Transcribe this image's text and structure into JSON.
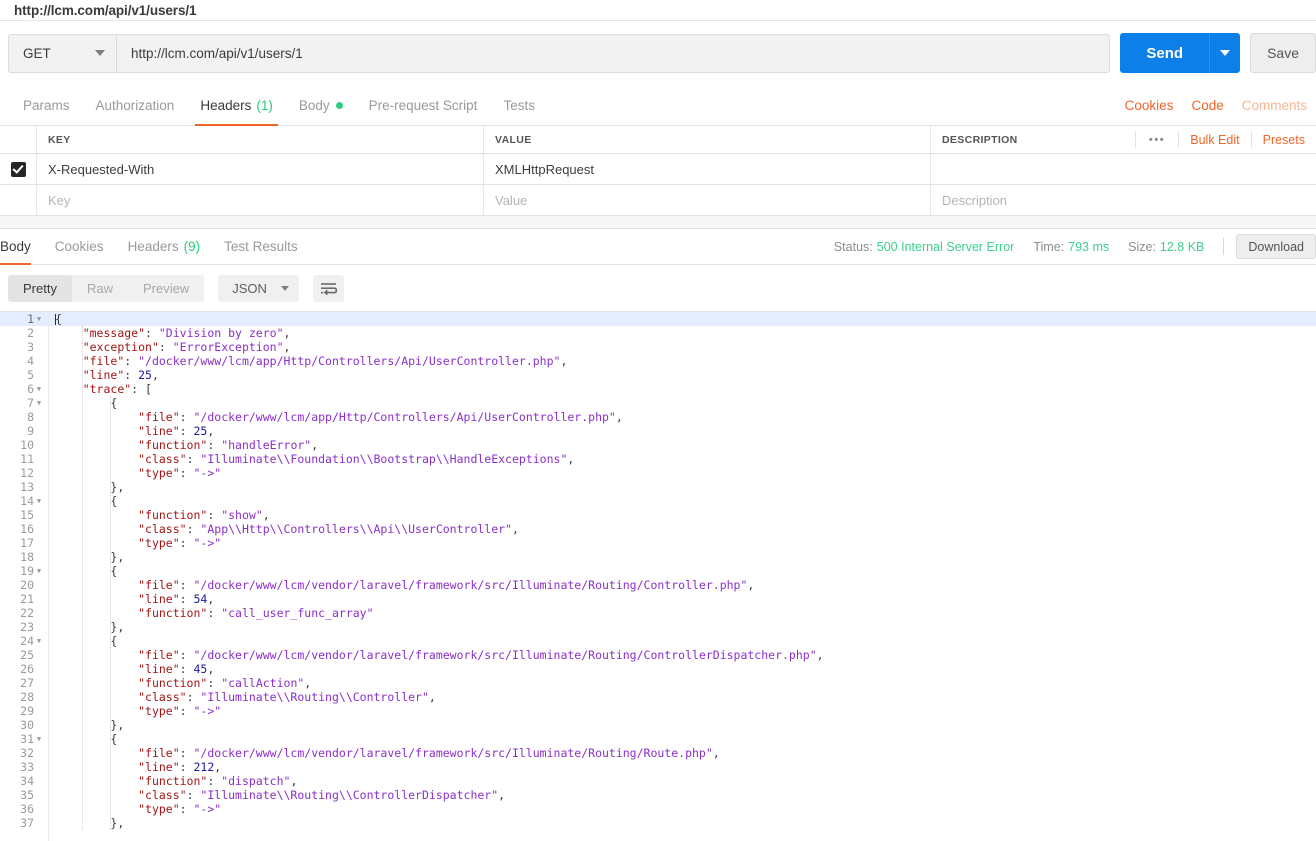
{
  "titlebar": {
    "request_title": "http://lcm.com/api/v1/users/1"
  },
  "request": {
    "method": "GET",
    "url": "http://lcm.com/api/v1/users/1",
    "send_label": "Send",
    "save_label": "Save",
    "tabs": [
      {
        "label": "Params",
        "active": false
      },
      {
        "label": "Authorization",
        "active": false
      },
      {
        "label": "Headers",
        "count": "(1)",
        "active": true
      },
      {
        "label": "Body",
        "dot": true,
        "active": false
      },
      {
        "label": "Pre-request Script",
        "active": false
      },
      {
        "label": "Tests",
        "active": false
      }
    ],
    "right_links": [
      {
        "label": "Cookies",
        "muted": false
      },
      {
        "label": "Code",
        "muted": false
      },
      {
        "label": "Comments",
        "muted": true
      }
    ]
  },
  "headers_table": {
    "columns": [
      "KEY",
      "VALUE",
      "DESCRIPTION"
    ],
    "more_dots": "•••",
    "bulk_edit_label": "Bulk Edit",
    "presets_label": "Presets",
    "rows": [
      {
        "checked": true,
        "key": "X-Requested-With",
        "value": "XMLHttpRequest",
        "description": ""
      }
    ],
    "placeholder_row": {
      "key": "Key",
      "value": "Value",
      "description": "Description"
    }
  },
  "response": {
    "tabs": [
      {
        "label": "Body",
        "active": true
      },
      {
        "label": "Cookies",
        "active": false
      },
      {
        "label": "Headers",
        "count": "(9)",
        "active": false
      },
      {
        "label": "Test Results",
        "active": false
      }
    ],
    "status_label": "Status:",
    "status_value": "500 Internal Server Error",
    "time_label": "Time:",
    "time_value": "793 ms",
    "size_label": "Size:",
    "size_value": "12.8 KB",
    "download_label": "Download",
    "view_modes": [
      {
        "label": "Pretty",
        "active": true
      },
      {
        "label": "Raw",
        "active": false
      },
      {
        "label": "Preview",
        "active": false
      }
    ],
    "format": "JSON",
    "wrap_icon": "word-wrap-icon"
  },
  "colors": {
    "accent_orange": "#f06529",
    "send_blue": "#0d7fe9",
    "status_green": "#3ccf8e",
    "active_line": "#e3edfd"
  },
  "code": {
    "active_line": 1,
    "fold_lines": [
      1,
      6,
      7,
      14,
      19,
      24,
      31
    ],
    "lines": [
      {
        "n": 1,
        "indent": 0,
        "tokens": [
          {
            "t": "punc",
            "v": "{"
          }
        ]
      },
      {
        "n": 2,
        "indent": 1,
        "tokens": [
          {
            "t": "key",
            "v": "\"message\""
          },
          {
            "t": "punc",
            "v": ": "
          },
          {
            "t": "str",
            "v": "\"Division by zero\""
          },
          {
            "t": "punc",
            "v": ","
          }
        ]
      },
      {
        "n": 3,
        "indent": 1,
        "tokens": [
          {
            "t": "key",
            "v": "\"exception\""
          },
          {
            "t": "punc",
            "v": ": "
          },
          {
            "t": "str",
            "v": "\"ErrorException\""
          },
          {
            "t": "punc",
            "v": ","
          }
        ]
      },
      {
        "n": 4,
        "indent": 1,
        "tokens": [
          {
            "t": "key",
            "v": "\"file\""
          },
          {
            "t": "punc",
            "v": ": "
          },
          {
            "t": "str",
            "v": "\"/docker/www/lcm/app/Http/Controllers/Api/UserController.php\""
          },
          {
            "t": "punc",
            "v": ","
          }
        ]
      },
      {
        "n": 5,
        "indent": 1,
        "tokens": [
          {
            "t": "key",
            "v": "\"line\""
          },
          {
            "t": "punc",
            "v": ": "
          },
          {
            "t": "num",
            "v": "25"
          },
          {
            "t": "punc",
            "v": ","
          }
        ]
      },
      {
        "n": 6,
        "indent": 1,
        "tokens": [
          {
            "t": "key",
            "v": "\"trace\""
          },
          {
            "t": "punc",
            "v": ": ["
          }
        ]
      },
      {
        "n": 7,
        "indent": 2,
        "tokens": [
          {
            "t": "punc",
            "v": "{"
          }
        ]
      },
      {
        "n": 8,
        "indent": 3,
        "tokens": [
          {
            "t": "key",
            "v": "\"file\""
          },
          {
            "t": "punc",
            "v": ": "
          },
          {
            "t": "str",
            "v": "\"/docker/www/lcm/app/Http/Controllers/Api/UserController.php\""
          },
          {
            "t": "punc",
            "v": ","
          }
        ]
      },
      {
        "n": 9,
        "indent": 3,
        "tokens": [
          {
            "t": "key",
            "v": "\"line\""
          },
          {
            "t": "punc",
            "v": ": "
          },
          {
            "t": "num",
            "v": "25"
          },
          {
            "t": "punc",
            "v": ","
          }
        ]
      },
      {
        "n": 10,
        "indent": 3,
        "tokens": [
          {
            "t": "key",
            "v": "\"function\""
          },
          {
            "t": "punc",
            "v": ": "
          },
          {
            "t": "str",
            "v": "\"handleError\""
          },
          {
            "t": "punc",
            "v": ","
          }
        ]
      },
      {
        "n": 11,
        "indent": 3,
        "tokens": [
          {
            "t": "key",
            "v": "\"class\""
          },
          {
            "t": "punc",
            "v": ": "
          },
          {
            "t": "str",
            "v": "\"Illuminate\\\\Foundation\\\\Bootstrap\\\\HandleExceptions\""
          },
          {
            "t": "punc",
            "v": ","
          }
        ]
      },
      {
        "n": 12,
        "indent": 3,
        "tokens": [
          {
            "t": "key",
            "v": "\"type\""
          },
          {
            "t": "punc",
            "v": ": "
          },
          {
            "t": "str",
            "v": "\"->\""
          }
        ]
      },
      {
        "n": 13,
        "indent": 2,
        "tokens": [
          {
            "t": "punc",
            "v": "},"
          }
        ]
      },
      {
        "n": 14,
        "indent": 2,
        "tokens": [
          {
            "t": "punc",
            "v": "{"
          }
        ]
      },
      {
        "n": 15,
        "indent": 3,
        "tokens": [
          {
            "t": "key",
            "v": "\"function\""
          },
          {
            "t": "punc",
            "v": ": "
          },
          {
            "t": "str",
            "v": "\"show\""
          },
          {
            "t": "punc",
            "v": ","
          }
        ]
      },
      {
        "n": 16,
        "indent": 3,
        "tokens": [
          {
            "t": "key",
            "v": "\"class\""
          },
          {
            "t": "punc",
            "v": ": "
          },
          {
            "t": "str",
            "v": "\"App\\\\Http\\\\Controllers\\\\Api\\\\UserController\""
          },
          {
            "t": "punc",
            "v": ","
          }
        ]
      },
      {
        "n": 17,
        "indent": 3,
        "tokens": [
          {
            "t": "key",
            "v": "\"type\""
          },
          {
            "t": "punc",
            "v": ": "
          },
          {
            "t": "str",
            "v": "\"->\""
          }
        ]
      },
      {
        "n": 18,
        "indent": 2,
        "tokens": [
          {
            "t": "punc",
            "v": "},"
          }
        ]
      },
      {
        "n": 19,
        "indent": 2,
        "tokens": [
          {
            "t": "punc",
            "v": "{"
          }
        ]
      },
      {
        "n": 20,
        "indent": 3,
        "tokens": [
          {
            "t": "key",
            "v": "\"file\""
          },
          {
            "t": "punc",
            "v": ": "
          },
          {
            "t": "str",
            "v": "\"/docker/www/lcm/vendor/laravel/framework/src/Illuminate/Routing/Controller.php\""
          },
          {
            "t": "punc",
            "v": ","
          }
        ]
      },
      {
        "n": 21,
        "indent": 3,
        "tokens": [
          {
            "t": "key",
            "v": "\"line\""
          },
          {
            "t": "punc",
            "v": ": "
          },
          {
            "t": "num",
            "v": "54"
          },
          {
            "t": "punc",
            "v": ","
          }
        ]
      },
      {
        "n": 22,
        "indent": 3,
        "tokens": [
          {
            "t": "key",
            "v": "\"function\""
          },
          {
            "t": "punc",
            "v": ": "
          },
          {
            "t": "str",
            "v": "\"call_user_func_array\""
          }
        ]
      },
      {
        "n": 23,
        "indent": 2,
        "tokens": [
          {
            "t": "punc",
            "v": "},"
          }
        ]
      },
      {
        "n": 24,
        "indent": 2,
        "tokens": [
          {
            "t": "punc",
            "v": "{"
          }
        ]
      },
      {
        "n": 25,
        "indent": 3,
        "tokens": [
          {
            "t": "key",
            "v": "\"file\""
          },
          {
            "t": "punc",
            "v": ": "
          },
          {
            "t": "str",
            "v": "\"/docker/www/lcm/vendor/laravel/framework/src/Illuminate/Routing/ControllerDispatcher.php\""
          },
          {
            "t": "punc",
            "v": ","
          }
        ]
      },
      {
        "n": 26,
        "indent": 3,
        "tokens": [
          {
            "t": "key",
            "v": "\"line\""
          },
          {
            "t": "punc",
            "v": ": "
          },
          {
            "t": "num",
            "v": "45"
          },
          {
            "t": "punc",
            "v": ","
          }
        ]
      },
      {
        "n": 27,
        "indent": 3,
        "tokens": [
          {
            "t": "key",
            "v": "\"function\""
          },
          {
            "t": "punc",
            "v": ": "
          },
          {
            "t": "str",
            "v": "\"callAction\""
          },
          {
            "t": "punc",
            "v": ","
          }
        ]
      },
      {
        "n": 28,
        "indent": 3,
        "tokens": [
          {
            "t": "key",
            "v": "\"class\""
          },
          {
            "t": "punc",
            "v": ": "
          },
          {
            "t": "str",
            "v": "\"Illuminate\\\\Routing\\\\Controller\""
          },
          {
            "t": "punc",
            "v": ","
          }
        ]
      },
      {
        "n": 29,
        "indent": 3,
        "tokens": [
          {
            "t": "key",
            "v": "\"type\""
          },
          {
            "t": "punc",
            "v": ": "
          },
          {
            "t": "str",
            "v": "\"->\""
          }
        ]
      },
      {
        "n": 30,
        "indent": 2,
        "tokens": [
          {
            "t": "punc",
            "v": "},"
          }
        ]
      },
      {
        "n": 31,
        "indent": 2,
        "tokens": [
          {
            "t": "punc",
            "v": "{"
          }
        ]
      },
      {
        "n": 32,
        "indent": 3,
        "tokens": [
          {
            "t": "key",
            "v": "\"file\""
          },
          {
            "t": "punc",
            "v": ": "
          },
          {
            "t": "str",
            "v": "\"/docker/www/lcm/vendor/laravel/framework/src/Illuminate/Routing/Route.php\""
          },
          {
            "t": "punc",
            "v": ","
          }
        ]
      },
      {
        "n": 33,
        "indent": 3,
        "tokens": [
          {
            "t": "key",
            "v": "\"line\""
          },
          {
            "t": "punc",
            "v": ": "
          },
          {
            "t": "num",
            "v": "212"
          },
          {
            "t": "punc",
            "v": ","
          }
        ]
      },
      {
        "n": 34,
        "indent": 3,
        "tokens": [
          {
            "t": "key",
            "v": "\"function\""
          },
          {
            "t": "punc",
            "v": ": "
          },
          {
            "t": "str",
            "v": "\"dispatch\""
          },
          {
            "t": "punc",
            "v": ","
          }
        ]
      },
      {
        "n": 35,
        "indent": 3,
        "tokens": [
          {
            "t": "key",
            "v": "\"class\""
          },
          {
            "t": "punc",
            "v": ": "
          },
          {
            "t": "str",
            "v": "\"Illuminate\\\\Routing\\\\ControllerDispatcher\""
          },
          {
            "t": "punc",
            "v": ","
          }
        ]
      },
      {
        "n": 36,
        "indent": 3,
        "tokens": [
          {
            "t": "key",
            "v": "\"type\""
          },
          {
            "t": "punc",
            "v": ": "
          },
          {
            "t": "str",
            "v": "\"->\""
          }
        ]
      },
      {
        "n": 37,
        "indent": 2,
        "tokens": [
          {
            "t": "punc",
            "v": "},"
          }
        ]
      }
    ]
  }
}
